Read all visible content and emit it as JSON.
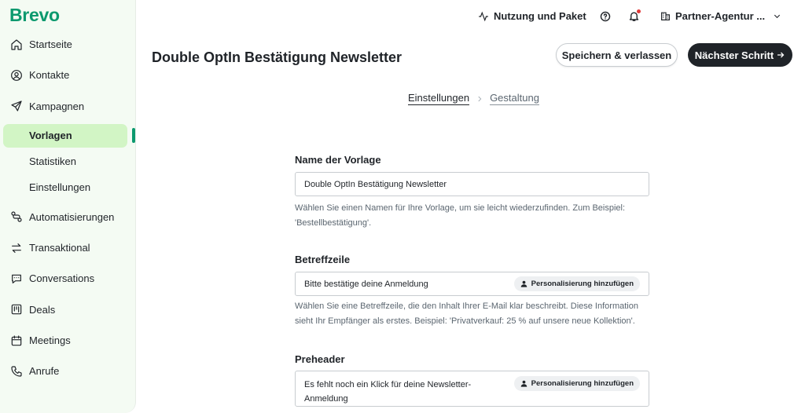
{
  "brand": {
    "logo": "Brevo",
    "color": "#0b996e"
  },
  "sidebar": {
    "items": [
      {
        "label": "Startseite",
        "icon": "home-icon"
      },
      {
        "label": "Kontakte",
        "icon": "contacts-icon"
      },
      {
        "label": "Kampagnen",
        "icon": "send-icon"
      }
    ],
    "sub_items": [
      {
        "label": "Vorlagen",
        "active": true
      },
      {
        "label": "Statistiken"
      },
      {
        "label": "Einstellungen"
      }
    ],
    "items_after": [
      {
        "label": "Automatisierungen",
        "icon": "automation-icon"
      },
      {
        "label": "Transaktional",
        "icon": "transfer-icon"
      },
      {
        "label": "Conversations",
        "icon": "chat-icon"
      },
      {
        "label": "Deals",
        "icon": "deals-icon"
      },
      {
        "label": "Meetings",
        "icon": "calendar-icon"
      },
      {
        "label": "Anrufe",
        "icon": "phone-icon"
      }
    ]
  },
  "topbar": {
    "usage_label": "Nutzung und Paket",
    "account_label": "Partner-Agentur ..."
  },
  "header": {
    "title": "Double OptIn Bestätigung Newsletter",
    "save_label": "Speichern & verlassen",
    "next_label": "Nächster Schritt"
  },
  "stepper": {
    "steps": [
      "Einstellungen",
      "Gestaltung"
    ],
    "active": 0
  },
  "form": {
    "name": {
      "label": "Name der Vorlage",
      "value": "Double OptIn Bestätigung Newsletter",
      "help": "Wählen Sie einen Namen für Ihre Vorlage, um sie leicht wiederzufinden. Zum Beispiel: 'Bestellbestätigung'."
    },
    "subject": {
      "label": "Betreffzeile",
      "value": "Bitte bestätige deine Anmeldung",
      "personalize_label": "Personalisierung hinzufügen",
      "help": "Wählen Sie eine Betreffzeile, die den Inhalt Ihrer E-Mail klar beschreibt. Diese Information sieht Ihr Empfänger als erstes. Beispiel: 'Privatverkauf: 25 % auf unsere neue Kollektion'."
    },
    "preheader": {
      "label": "Preheader",
      "value": "Es fehlt noch ein Klick für deine Newsletter-Anmeldung",
      "personalize_label": "Personalisierung hinzufügen"
    }
  }
}
